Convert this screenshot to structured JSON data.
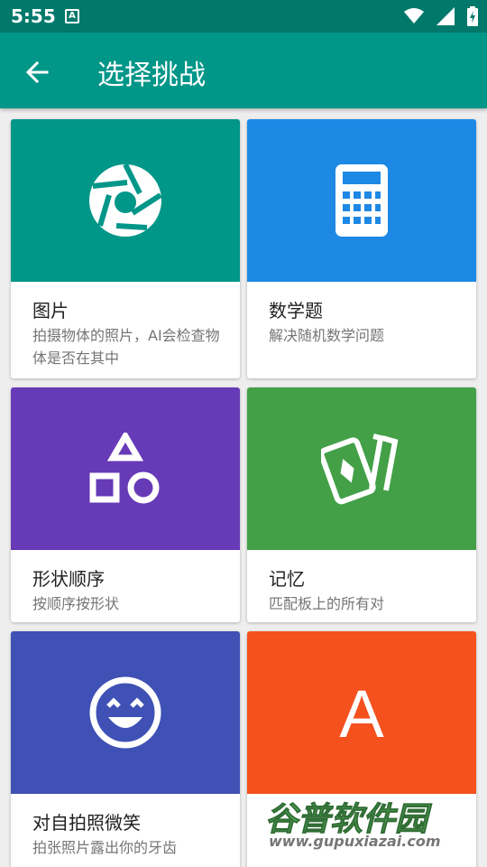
{
  "status_bar": {
    "time": "5:55",
    "notification_icon": "a-badge-icon",
    "wifi_icon": "wifi-icon",
    "signal_icon": "signal-icon",
    "battery_icon": "battery-charging-icon"
  },
  "app_bar": {
    "title": "选择挑战",
    "back_icon": "arrow-back-icon"
  },
  "colors": {
    "status_bar": "#00796b",
    "app_bar": "#009688",
    "picture": "#009688",
    "math": "#1e88e5",
    "shape": "#673ab7",
    "memory": "#43a047",
    "smile": "#3f51b5",
    "typing": "#f4511e"
  },
  "challenges": [
    {
      "title": "图片",
      "description": "拍摄物体的照片，AI会检查物体是否在其中",
      "icon": "camera-aperture-icon"
    },
    {
      "title": "数学题",
      "description": "解决随机数学问题",
      "icon": "calculator-icon"
    },
    {
      "title": "形状顺序",
      "description": "按顺序按形状",
      "icon": "shapes-icon"
    },
    {
      "title": "记忆",
      "description": "匹配板上的所有对",
      "icon": "cards-icon"
    },
    {
      "title": "对自拍照微笑",
      "description": "拍张照片露出你的牙齿",
      "icon": "smile-face-icon"
    },
    {
      "title": "",
      "description": "",
      "icon": "letter-a-icon",
      "icon_text": "A"
    }
  ],
  "watermark": {
    "text": "谷普软件园",
    "url": "www.gupuxiazai.com"
  }
}
